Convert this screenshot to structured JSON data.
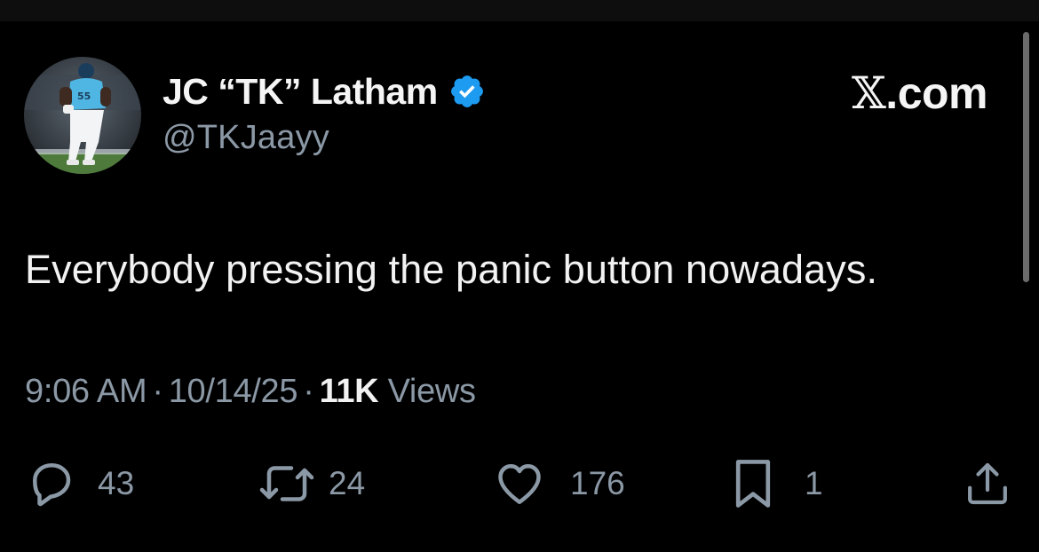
{
  "author": {
    "display_name": "JC “TK” Latham",
    "handle": "@TKJaayy",
    "verified": true,
    "verified_badge_color": "#1d9bf0",
    "avatar_icon": "avatar-photo"
  },
  "brand": {
    "prefix": "𝕏",
    "suffix": ".com"
  },
  "tweet": {
    "text": "Everybody pressing the panic button nowadays.",
    "time": "9:06 AM",
    "date": "10/14/25",
    "separator": "·",
    "views_count": "11K",
    "views_label": "Views"
  },
  "actions": {
    "replies": {
      "icon": "reply-icon",
      "count": "43"
    },
    "reposts": {
      "icon": "repost-icon",
      "count": "24"
    },
    "likes": {
      "icon": "heart-icon",
      "count": "176"
    },
    "bookmarks": {
      "icon": "bookmark-icon",
      "count": "1"
    },
    "share": {
      "icon": "share-icon"
    }
  },
  "colors": {
    "background": "#000000",
    "primary_text": "#e7e9ea",
    "secondary_text": "#8b98a5",
    "accent": "#1d9bf0"
  }
}
